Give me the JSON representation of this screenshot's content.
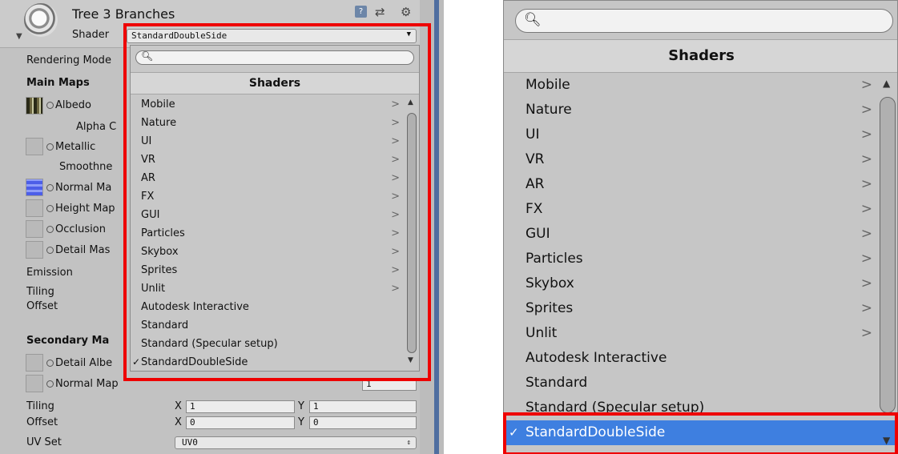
{
  "inspector": {
    "object_name": "Tree 3 Branches",
    "shader_label": "Shader",
    "shader_value": "StandardDoubleSide",
    "icons": {
      "help": "help-icon",
      "preset": "preset-icon",
      "settings": "gear-icon",
      "dropdown": "triangle-down-icon",
      "search": "magnifier-icon",
      "submenu": "chevron-right-icon",
      "check": "checkmark-icon"
    },
    "properties": {
      "rendering_mode": "Rendering Mode",
      "main_maps": "Main Maps",
      "albedo": "Albedo",
      "alpha": "Alpha C",
      "metallic": "Metallic",
      "smoothness": "Smoothne",
      "normal_map": "Normal Ma",
      "height_map": "Height Map",
      "occlusion": "Occlusion",
      "detail_mask": "Detail Mas",
      "emission": "Emission",
      "tiling": "Tiling",
      "offset": "Offset",
      "secondary_maps": "Secondary Ma",
      "detail_albedo": "Detail Albe",
      "secondary_normal_map": "Normal Map",
      "normal_scale": "1",
      "sec_tiling": "Tiling",
      "sec_offset": "Offset",
      "x_label": "X",
      "y_label": "Y",
      "tiling_x": "1",
      "tiling_y": "1",
      "offset_x": "0",
      "offset_y": "0",
      "uv_set": "UV Set",
      "uv_value": "UV0"
    }
  },
  "shader_menu": {
    "title": "Shaders",
    "search_value": "",
    "scroll_up": "▲",
    "scroll_down": "▼",
    "submenu_glyph": ">",
    "check_glyph": "✓",
    "items": [
      {
        "label": "Mobile",
        "submenu": true
      },
      {
        "label": "Nature",
        "submenu": true
      },
      {
        "label": "UI",
        "submenu": true
      },
      {
        "label": "VR",
        "submenu": true
      },
      {
        "label": "AR",
        "submenu": true
      },
      {
        "label": "FX",
        "submenu": true
      },
      {
        "label": "GUI",
        "submenu": true
      },
      {
        "label": "Particles",
        "submenu": true
      },
      {
        "label": "Skybox",
        "submenu": true
      },
      {
        "label": "Sprites",
        "submenu": true
      },
      {
        "label": "Unlit",
        "submenu": true
      },
      {
        "label": "Autodesk Interactive",
        "submenu": false
      },
      {
        "label": "Standard",
        "submenu": false
      },
      {
        "label": "Standard (Specular setup)",
        "submenu": false
      },
      {
        "label": "StandardDoubleSide",
        "submenu": false,
        "selected": true
      }
    ]
  },
  "colors": {
    "highlight": "#ee0000",
    "selection": "#3e7fe0",
    "panel": "#c2c2c2"
  }
}
